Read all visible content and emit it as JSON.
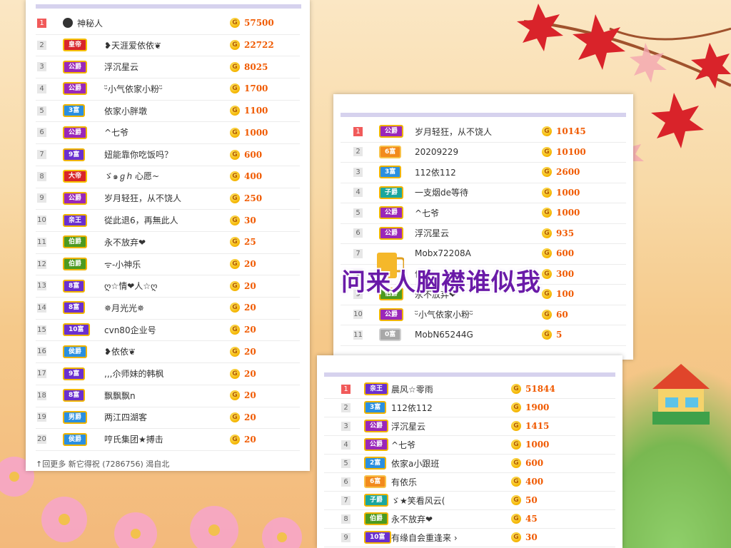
{
  "panel_left": {
    "rows": [
      {
        "rank": "1",
        "badge": "",
        "badge_style": "none",
        "name": "神秘人",
        "score": "57500"
      },
      {
        "rank": "2",
        "badge": "皇帝",
        "badge_style": "red",
        "name": "❥天涯爱依依❦",
        "score": "22722"
      },
      {
        "rank": "3",
        "badge": "公爵",
        "badge_style": "purple",
        "name": "浮沉星云",
        "score": "8025"
      },
      {
        "rank": "4",
        "badge": "公爵",
        "badge_style": "purple",
        "name": "ᵕ̈小气依家小粉ᵕ̈",
        "score": "1700"
      },
      {
        "rank": "5",
        "badge": "3富",
        "badge_style": "blue",
        "name": "依家小胖墩",
        "score": "1100"
      },
      {
        "rank": "6",
        "badge": "公爵",
        "badge_style": "purple",
        "name": "^七爷",
        "score": "1000"
      },
      {
        "rank": "7",
        "badge": "9富",
        "badge_style": "violet",
        "name": "妞能靠你吃饭吗？",
        "score": "600"
      },
      {
        "rank": "8",
        "badge": "大帝",
        "badge_style": "red",
        "name": "ゞ๑ℊℎ 心愿~",
        "score": "400"
      },
      {
        "rank": "9",
        "badge": "公爵",
        "badge_style": "purple",
        "name": "岁月轻狂，从不饶人",
        "score": "250"
      },
      {
        "rank": "10",
        "badge": "亲王",
        "badge_style": "violet",
        "name": "從此退6，再無此人",
        "score": "30"
      },
      {
        "rank": "11",
        "badge": "伯爵",
        "badge_style": "green",
        "name": "永不放弃❤",
        "score": "25"
      },
      {
        "rank": "12",
        "badge": "伯爵",
        "badge_style": "green",
        "name": "ᯤ-小神乐",
        "score": "20"
      },
      {
        "rank": "13",
        "badge": "8富",
        "badge_style": "violet",
        "name": "ღ☆情❤人☆ღ",
        "score": "20"
      },
      {
        "rank": "14",
        "badge": "8富",
        "badge_style": "violet",
        "name": "✵月光光✵",
        "score": "20"
      },
      {
        "rank": "15",
        "badge": "10富",
        "badge_style": "violet",
        "name": "cvn80企业号",
        "score": "20"
      },
      {
        "rank": "16",
        "badge": "侯爵",
        "badge_style": "blue",
        "name": "❥依依❦",
        "score": "20"
      },
      {
        "rank": "17",
        "badge": "9富",
        "badge_style": "violet",
        "name": ",,,尒师妹的韩枫",
        "score": "20"
      },
      {
        "rank": "18",
        "badge": "8富",
        "badge_style": "violet",
        "name": "飘飘飘n",
        "score": "20"
      },
      {
        "rank": "19",
        "badge": "男爵",
        "badge_style": "blue",
        "name": "两江四湖客",
        "score": "20"
      },
      {
        "rank": "20",
        "badge": "侯爵",
        "badge_style": "blue",
        "name": "哼氏集团★搏击",
        "score": "20"
      }
    ],
    "cutoff_text": "↑回更多      新它得祝      (7286756)  渴自北"
  },
  "panel_mid": {
    "rows": [
      {
        "rank": "1",
        "badge": "公爵",
        "badge_style": "purple",
        "name": "岁月轻狂，从不饶人",
        "score": "10145"
      },
      {
        "rank": "2",
        "badge": "6富",
        "badge_style": "orange",
        "name": "20209229",
        "score": "10100"
      },
      {
        "rank": "3",
        "badge": "3富",
        "badge_style": "blue",
        "name": "112依112",
        "score": "2600"
      },
      {
        "rank": "4",
        "badge": "子爵",
        "badge_style": "teal",
        "name": "一支烟de等待",
        "score": "1000"
      },
      {
        "rank": "5",
        "badge": "公爵",
        "badge_style": "purple",
        "name": "^七爷",
        "score": "1000"
      },
      {
        "rank": "6",
        "badge": "公爵",
        "badge_style": "purple",
        "name": "浮沉星云",
        "score": "935"
      },
      {
        "rank": "7",
        "badge": "",
        "badge_style": "none",
        "name": "Mobx72208A",
        "score": "600"
      },
      {
        "rank": "8",
        "badge": "",
        "badge_style": "none",
        "name": "依",
        "score": "300"
      },
      {
        "rank": "9",
        "badge": "伯爵",
        "badge_style": "green",
        "name": "永不放弃❤",
        "score": "100"
      },
      {
        "rank": "10",
        "badge": "公爵",
        "badge_style": "purple",
        "name": "ᵕ̈小气依家小粉ᵕ̈",
        "score": "60"
      },
      {
        "rank": "11",
        "badge": "0富",
        "badge_style": "gray",
        "name": "MobN65244G",
        "score": "5"
      }
    ]
  },
  "panel_right": {
    "rows": [
      {
        "rank": "1",
        "badge": "亲王",
        "badge_style": "violet",
        "name": "晨风☆零雨",
        "score": "51844"
      },
      {
        "rank": "2",
        "badge": "3富",
        "badge_style": "blue",
        "name": "112依112",
        "score": "1900"
      },
      {
        "rank": "3",
        "badge": "公爵",
        "badge_style": "purple",
        "name": "浮沉星云",
        "score": "1415"
      },
      {
        "rank": "4",
        "badge": "公爵",
        "badge_style": "purple",
        "name": "^七爷",
        "score": "1000"
      },
      {
        "rank": "5",
        "badge": "2富",
        "badge_style": "blue",
        "name": "依家a小跟班",
        "score": "600"
      },
      {
        "rank": "6",
        "badge": "6富",
        "badge_style": "orange",
        "name": "有依乐",
        "score": "400"
      },
      {
        "rank": "7",
        "badge": "子爵",
        "badge_style": "teal",
        "name": "ゞ★笑看风云(",
        "score": "50"
      },
      {
        "rank": "8",
        "badge": "伯爵",
        "badge_style": "green",
        "name": "永不放弃❤",
        "score": "45"
      },
      {
        "rank": "9",
        "badge": "10富",
        "badge_style": "violet",
        "name": "有缘自会重逢来 ›",
        "score": "30"
      }
    ]
  },
  "overlay": {
    "text": "问来人胸襟谁似我"
  },
  "coin_glyph": "G",
  "colors": {
    "score": "#f05a00",
    "rank_top": "#f15a5a",
    "topbar": "#d6d2ee"
  }
}
